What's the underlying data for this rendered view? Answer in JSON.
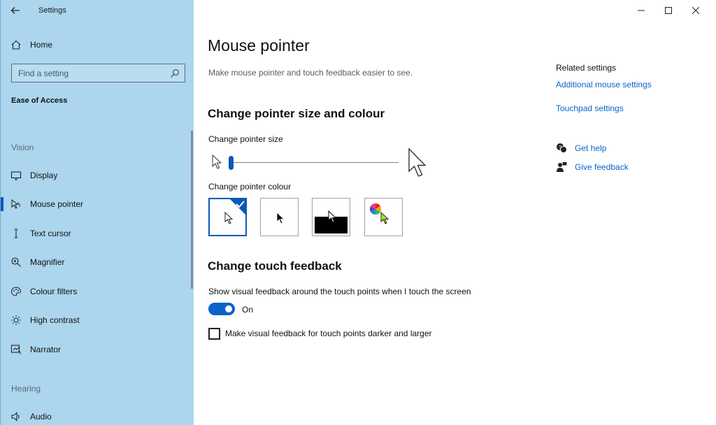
{
  "app": {
    "title": "Settings"
  },
  "sidebar": {
    "home_label": "Home",
    "search_placeholder": "Find a setting",
    "section_title": "Ease of Access",
    "groups": [
      {
        "label": "Vision"
      },
      {
        "label": "Hearing"
      }
    ],
    "items": [
      {
        "label": "Display",
        "icon": "display-icon"
      },
      {
        "label": "Mouse pointer",
        "icon": "mouse-pointer-icon",
        "selected": true
      },
      {
        "label": "Text cursor",
        "icon": "text-cursor-icon"
      },
      {
        "label": "Magnifier",
        "icon": "magnifier-icon"
      },
      {
        "label": "Colour filters",
        "icon": "colour-filters-icon"
      },
      {
        "label": "High contrast",
        "icon": "high-contrast-icon"
      },
      {
        "label": "Narrator",
        "icon": "narrator-icon"
      },
      {
        "label": "Audio",
        "icon": "audio-icon"
      }
    ]
  },
  "main": {
    "title": "Mouse pointer",
    "description": "Make mouse pointer and touch feedback easier to see.",
    "pointer_section": {
      "heading": "Change pointer size and colour",
      "size_label": "Change pointer size",
      "size_value": 1,
      "size_min": 1,
      "size_max": 15,
      "colour_label": "Change pointer colour",
      "colour_options": [
        "white",
        "black",
        "inverted",
        "custom"
      ],
      "selected_colour": "white"
    },
    "touch_section": {
      "heading": "Change touch feedback",
      "toggle_label": "Show visual feedback around the touch points when I touch the screen",
      "toggle_state": "On",
      "checkbox_label": "Make visual feedback for touch points darker and larger",
      "checkbox_checked": false
    }
  },
  "related": {
    "title": "Related settings",
    "links": [
      "Additional mouse settings",
      "Touchpad settings"
    ],
    "help_links": [
      {
        "label": "Get help",
        "icon": "get-help-icon"
      },
      {
        "label": "Give feedback",
        "icon": "give-feedback-icon"
      }
    ]
  },
  "colors": {
    "accent": "#0a58b8",
    "sidebar_bg": "#acd6ee",
    "link": "#0a64c8",
    "custom_pointer": "#b5e61d"
  }
}
